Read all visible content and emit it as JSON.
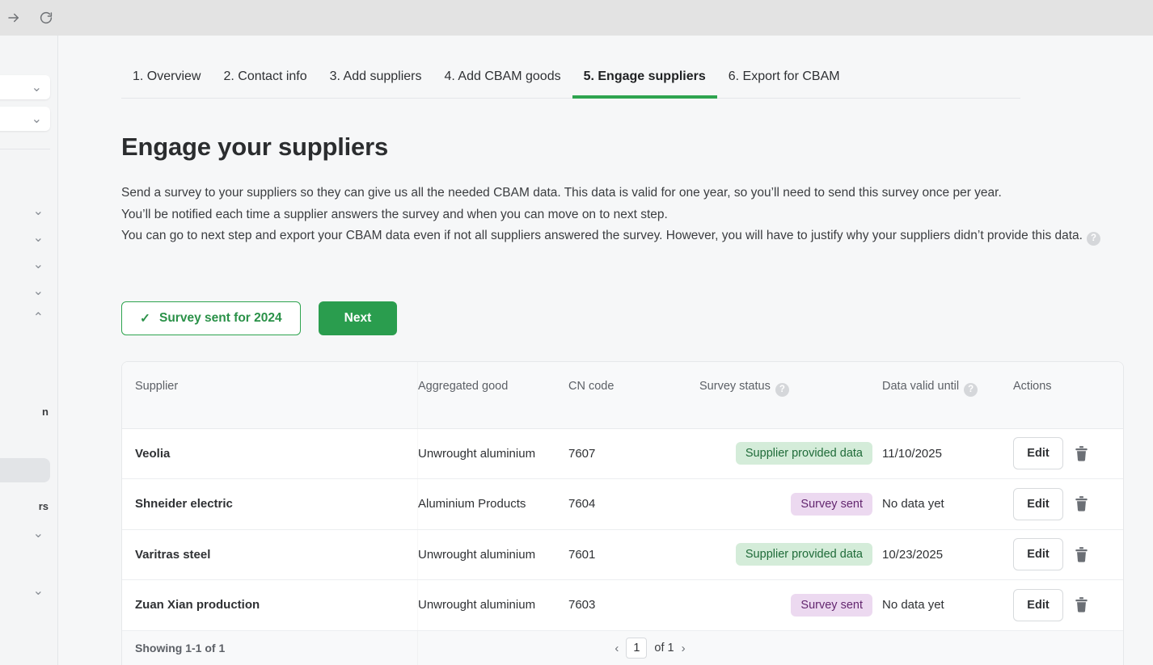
{
  "browser": {
    "forward_icon": "forward-arrow-icon",
    "reload_icon": "reload-icon"
  },
  "sidebar": {
    "selects": [
      {
        "chevron": "⌄"
      },
      {
        "chevron": "⌄"
      }
    ],
    "groups": [
      {
        "chevron": "⌄",
        "state": "collapsed"
      },
      {
        "chevron": "⌄",
        "state": "collapsed"
      },
      {
        "chevron": "⌄",
        "state": "collapsed"
      },
      {
        "chevron": "⌄",
        "state": "collapsed"
      },
      {
        "chevron": "⌃",
        "state": "expanded"
      }
    ],
    "clipped_labels": [
      {
        "text": "n"
      },
      {
        "text": "rs"
      }
    ],
    "bottom_groups": [
      {
        "chevron": "⌄",
        "state": "collapsed"
      },
      {
        "chevron": "⌄",
        "state": "collapsed"
      }
    ]
  },
  "tabs": [
    {
      "label": "1. Overview",
      "active": false
    },
    {
      "label": "2. Contact info",
      "active": false
    },
    {
      "label": "3. Add suppliers",
      "active": false
    },
    {
      "label": "4. Add CBAM goods",
      "active": false
    },
    {
      "label": "5. Engage suppliers",
      "active": true
    },
    {
      "label": "6. Export for CBAM",
      "active": false
    }
  ],
  "page": {
    "title": "Engage your suppliers",
    "paragraph_1": "Send a survey to your suppliers so they can give us all the needed CBAM data. This data is valid for one year, so you’ll need to send this survey once per year.",
    "paragraph_2": "You’ll be notified each time a supplier answers the survey and when you can move on to next step.",
    "paragraph_3": "You can go to next step and export your CBAM data even if not all suppliers answered the survey. However, you will have to justify why your suppliers didn’t provide this data.",
    "help_glyph": "?"
  },
  "buttons": {
    "survey_sent_label": "Survey sent for 2024",
    "survey_sent_check": "✓",
    "next_label": "Next"
  },
  "table": {
    "headers": {
      "supplier": "Supplier",
      "aggregated_good": "Aggregated good",
      "cn_code": "CN code",
      "survey_status": "Survey status",
      "data_valid_until": "Data valid until",
      "actions": "Actions"
    },
    "rows": [
      {
        "supplier": "Veolia",
        "good": "Unwrought aluminium",
        "cn_code": "7607",
        "status": "Supplier provided data",
        "status_kind": "green",
        "valid_until": "11/10/2025",
        "edit_label": "Edit",
        "delete_icon": "trash-icon"
      },
      {
        "supplier": "Shneider electric",
        "good": "Aluminium Products",
        "cn_code": "7604",
        "status": "Survey sent",
        "status_kind": "purple",
        "valid_until": "No data yet",
        "edit_label": "Edit",
        "delete_icon": "trash-icon"
      },
      {
        "supplier": "Varitras steel",
        "good": "Unwrought aluminium",
        "cn_code": "7601",
        "status": "Supplier provided data",
        "status_kind": "green",
        "valid_until": "10/23/2025",
        "edit_label": "Edit",
        "delete_icon": "trash-icon"
      },
      {
        "supplier": "Zuan Xian production",
        "good": "Unwrought aluminium",
        "cn_code": "7603",
        "status": "Survey sent",
        "status_kind": "purple",
        "valid_until": "No data yet",
        "edit_label": "Edit",
        "delete_icon": "trash-icon"
      }
    ],
    "footer": {
      "showing": "Showing 1-1 of 1",
      "prev_arrow": "‹",
      "current_page": "1",
      "of_label": "of 1",
      "next_arrow": "›"
    }
  },
  "colors": {
    "brand_green": "#2a9d4e",
    "tab_underline": "#2ea44f",
    "badge_green_bg": "#d4ecd9",
    "badge_green_text": "#1f6b39",
    "badge_purple_bg": "#ecd9f0",
    "badge_purple_text": "#63266f",
    "page_bg": "#f6f7f8",
    "header_bg": "#f8f9fa"
  }
}
